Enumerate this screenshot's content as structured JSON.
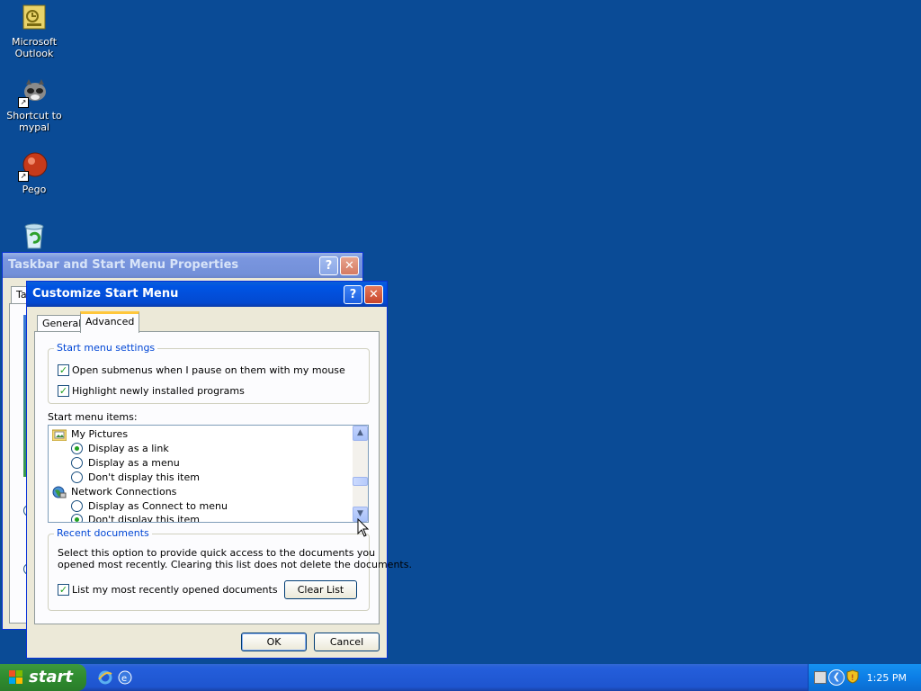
{
  "desktop": {
    "icons": [
      {
        "label_line1": "Microsoft",
        "label_line2": "Outlook"
      },
      {
        "label_line1": "Shortcut to",
        "label_line2": "mypal"
      },
      {
        "label_line1": "Pego",
        "label_line2": ""
      },
      {
        "label_line1": "",
        "label_line2": ""
      }
    ]
  },
  "back_window": {
    "title": "Taskbar and Start Menu Properties",
    "tab_partial": "Ta"
  },
  "dialog": {
    "title": "Customize Start Menu",
    "tabs": [
      "General",
      "Advanced"
    ],
    "selected_tab": "Advanced",
    "start_menu_settings": {
      "title": "Start menu settings",
      "options": [
        {
          "label": "Open submenus when I pause on them with my mouse",
          "checked": true
        },
        {
          "label": "Highlight newly installed programs",
          "checked": true
        }
      ]
    },
    "start_menu_items": {
      "label": "Start menu items:",
      "entries": [
        {
          "kind": "header",
          "label": "My Pictures",
          "icon": "pictures-folder-icon"
        },
        {
          "kind": "radio",
          "label": "Display as a link",
          "selected": true
        },
        {
          "kind": "radio",
          "label": "Display as a menu",
          "selected": false
        },
        {
          "kind": "radio",
          "label": "Don't display this item",
          "selected": false
        },
        {
          "kind": "header",
          "label": "Network Connections",
          "icon": "network-globe-icon"
        },
        {
          "kind": "radio",
          "label": "Display as Connect to menu",
          "selected": false
        },
        {
          "kind": "radio",
          "label": "Don't display this item",
          "selected": true
        }
      ]
    },
    "recent_documents": {
      "title": "Recent documents",
      "description_line1": "Select this option to provide quick access to the documents you",
      "description_line2": "opened most recently.  Clearing this list does not delete the documents.",
      "checkbox_label": "List my most recently opened documents",
      "checked": true,
      "clear_button": "Clear List"
    },
    "ok_button": "OK",
    "cancel_button": "Cancel"
  },
  "taskbar": {
    "start_label": "start",
    "clock": "1:25 PM"
  },
  "colors": {
    "desktop": "#0a4b96",
    "title_active": "#0054e3",
    "group_title": "#0046d5",
    "check_green": "#21a121"
  }
}
